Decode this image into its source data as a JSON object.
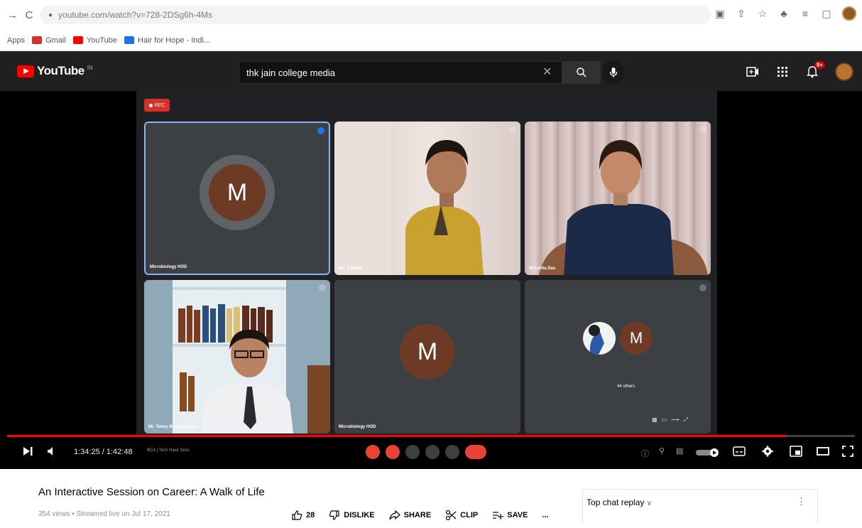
{
  "browser": {
    "url": "youtube.com/watch?v=728-2DSg6h-4Ms",
    "bookmarks": [
      {
        "label": "Apps",
        "color": ""
      },
      {
        "label": "Gmail",
        "color": "#d93025"
      },
      {
        "label": "YouTube",
        "color": "#ff0000"
      },
      {
        "label": "Hair for Hope - Indi...",
        "color": "#1a73e8"
      }
    ]
  },
  "youtube": {
    "logo_text": "YouTube",
    "region": "IN",
    "search_query": "thk jain college media",
    "notification_count": "9+"
  },
  "meet": {
    "rec_label": "REC",
    "tiles": [
      {
        "name": "Microbiology HOD",
        "avatar_letter": "M"
      },
      {
        "name": "Ms. T Dutta",
        "avatar_letter": ""
      },
      {
        "name": "Moumita Das",
        "avatar_letter": ""
      },
      {
        "name": "Mr. Tanoy Bhattacharya",
        "avatar_letter": ""
      },
      {
        "name": "Microbiology HOD",
        "avatar_letter": "M"
      },
      {
        "name": "",
        "avatar_letter": "M",
        "others_label": "44 others"
      }
    ]
  },
  "player": {
    "time": "1:34:25 / 1:42:48",
    "chapter": "BCA | Tech Hack Sess",
    "progress": 0.92
  },
  "video": {
    "title": "An Interactive Session on Career: A Walk of Life",
    "meta": "354 views • Streamed live on Jul 17, 2021",
    "likes": "28",
    "dislike": "DISLIKE",
    "share": "SHARE",
    "clip": "CLIP",
    "save": "SAVE",
    "more": "..."
  },
  "chat": {
    "title": "Top chat replay",
    "chevron": "∨",
    "menu": "⋮"
  },
  "colors": {
    "yt_red": "#ff0000",
    "meet_bg": "#202124",
    "tile_bg": "#3c4043",
    "avatar_brown": "#6d3a25"
  }
}
